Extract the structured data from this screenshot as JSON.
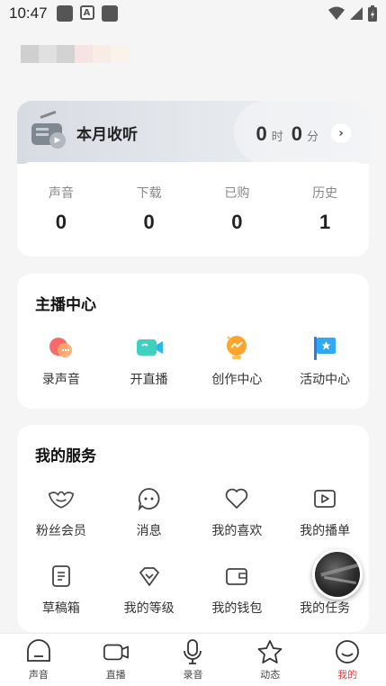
{
  "status_bar": {
    "time": "10:47",
    "a_label": "A"
  },
  "listen_card": {
    "title": "本月收听",
    "hours": "0",
    "hours_unit": "时",
    "minutes": "0",
    "minutes_unit": "分",
    "stats": [
      {
        "label": "声音",
        "value": "0"
      },
      {
        "label": "下载",
        "value": "0"
      },
      {
        "label": "已购",
        "value": "0"
      },
      {
        "label": "历史",
        "value": "1"
      }
    ]
  },
  "anchor_center": {
    "title": "主播中心",
    "items": [
      {
        "label": "录声音",
        "icon": "record-sound-icon"
      },
      {
        "label": "开直播",
        "icon": "live-camera-icon"
      },
      {
        "label": "创作中心",
        "icon": "creator-bulb-icon"
      },
      {
        "label": "活动中心",
        "icon": "activity-flag-icon"
      }
    ]
  },
  "services": {
    "title": "我的服务",
    "items": [
      {
        "label": "粉丝会员",
        "icon": "fan-member-icon"
      },
      {
        "label": "消息",
        "icon": "message-icon"
      },
      {
        "label": "我的喜欢",
        "icon": "heart-icon"
      },
      {
        "label": "我的播单",
        "icon": "playlist-icon"
      },
      {
        "label": "草稿箱",
        "icon": "draft-icon"
      },
      {
        "label": "我的等级",
        "icon": "level-diamond-icon"
      },
      {
        "label": "我的钱包",
        "icon": "wallet-icon"
      },
      {
        "label": "我的任务",
        "icon": "task-icon"
      }
    ]
  },
  "tabbar": {
    "items": [
      {
        "label": "声音",
        "icon": "sound-home-icon"
      },
      {
        "label": "直播",
        "icon": "live-icon"
      },
      {
        "label": "录音",
        "icon": "microphone-icon"
      },
      {
        "label": "动态",
        "icon": "star-icon"
      },
      {
        "label": "我的",
        "icon": "profile-face-icon",
        "active": true
      }
    ]
  },
  "colors": {
    "accent": "#f23b3b",
    "background": "#f5f5f5"
  }
}
